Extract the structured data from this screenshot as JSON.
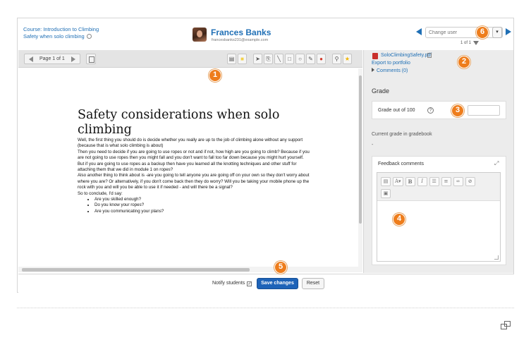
{
  "header": {
    "course_link": "Course: Introduction to Climbing",
    "assignment_link": "Safety when solo climbing",
    "user_name": "Frances Banks",
    "user_email": "francesbanks231@example.com",
    "change_user_placeholder": "Change user",
    "dropdown_glyph": "▾",
    "counter": "1 of 1"
  },
  "toolbar": {
    "page_label": "Page 1 of 1",
    "tools": [
      {
        "icon": "comment-icon",
        "glyph": "▤"
      },
      {
        "icon": "highlight-color-icon",
        "glyph": "■"
      },
      {
        "icon": "select-pointer-icon",
        "glyph": "➤"
      },
      {
        "icon": "stamp-icon",
        "glyph": "⎘"
      },
      {
        "icon": "line-icon",
        "glyph": "╲"
      },
      {
        "icon": "rectangle-icon",
        "glyph": "□"
      },
      {
        "icon": "oval-icon",
        "glyph": "○"
      },
      {
        "icon": "pen-icon",
        "glyph": "✎"
      },
      {
        "icon": "color-drop-icon",
        "glyph": "●"
      },
      {
        "icon": "stamp-person-icon",
        "glyph": "⚲"
      },
      {
        "icon": "star-stamp-icon",
        "glyph": "★"
      }
    ]
  },
  "document": {
    "title": "Safety considerations when solo climbing",
    "paragraphs": [
      "Well, the first thing you should do is decide whether you really are up to the job of climbing alone without any support (because that is what solo climbing is about)",
      "Then you need to decide if you are going to use ropes or not and if not, how high are you going to climb? Because if you are not going to use ropes then you might fall and you don't want to fall too far down because you might hurt yourself.",
      "But if you are going to use ropes as a backup then have you learned all the knotting techniques and other stuff for attaching them that we did in module 1 on ropes?",
      "Also another thing to think about is -are you going to tell anyone you are going off on your own so they don't worry about where you are? Or alternatively, if you don't come back then they do worry? Will you be taking your mobile phone up the rock with you and will you be able to use it if needed - and will there be a signal?",
      "So to conclude, I'd say:"
    ],
    "bullets": [
      "Are you skilled enough?",
      "Do you know your ropes?",
      "Are you communicating your plans?"
    ]
  },
  "sidebar": {
    "file_name": "SoloClimbingSafety.pdf",
    "export_link": "Export to portfolio",
    "comments_link": "Comments (0)",
    "grade_heading": "Grade",
    "grade_label": "Grade out of 100",
    "help_glyph": "?",
    "current_grade_label": "Current grade in gradebook",
    "current_grade_value": "-",
    "feedback_label": "Feedback comments",
    "expand_glyph": "⤢",
    "editor_buttons_row1": [
      {
        "icon": "toolbar-toggle-icon",
        "glyph": "▤"
      },
      {
        "icon": "font-color-icon",
        "glyph": "A▾"
      },
      {
        "icon": "bold-icon",
        "glyph": "B"
      },
      {
        "icon": "italic-icon",
        "glyph": "I"
      },
      {
        "icon": "bullet-list-icon",
        "glyph": "☰"
      },
      {
        "icon": "numbered-list-icon",
        "glyph": "≡"
      },
      {
        "icon": "link-icon",
        "glyph": "∞"
      },
      {
        "icon": "unlink-icon",
        "glyph": "⊘"
      }
    ],
    "editor_buttons_row2": [
      {
        "icon": "image-icon",
        "glyph": "▣"
      }
    ]
  },
  "footer": {
    "notify_label": "Notify students",
    "notify_checked": "✓",
    "save_label": "Save changes",
    "reset_label": "Reset"
  },
  "callouts": [
    "1",
    "2",
    "3",
    "4",
    "5",
    "6"
  ],
  "colors": {
    "link": "#1f6fb5",
    "primary_button": "#1e63b8",
    "callout": "#ee7d1c",
    "pdf_icon": "#c9302c"
  }
}
